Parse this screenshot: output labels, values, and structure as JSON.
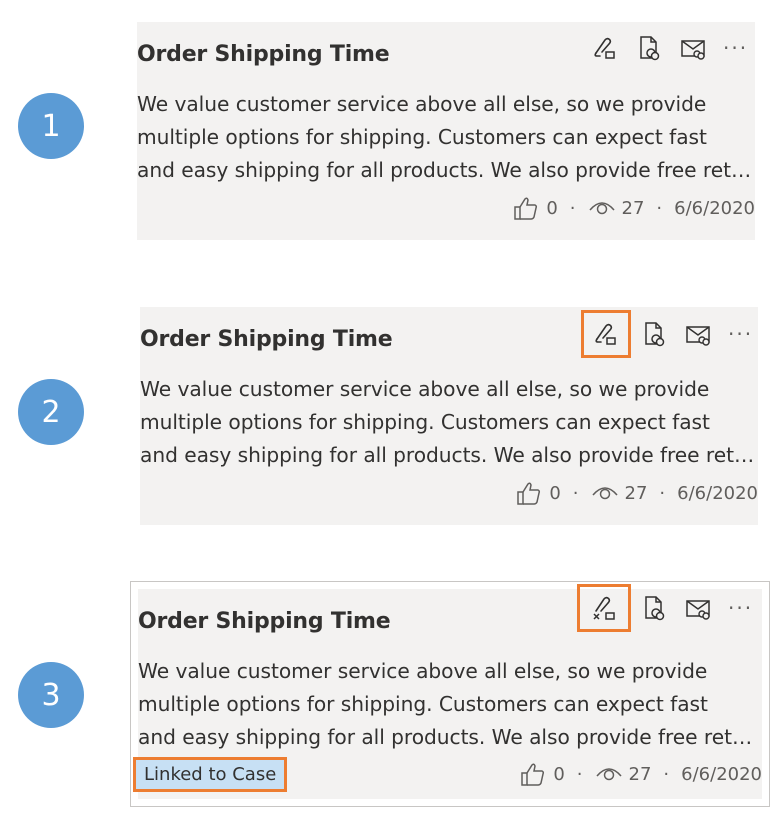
{
  "cards": [
    {
      "step": "1",
      "title": "Order Shipping Time",
      "lines": [
        "We value customer service above all else, so we provide",
        "multiple options for shipping. Customers can expect fast",
        "and easy shipping for all products. We also provide free returns"
      ],
      "likes": "0",
      "views": "27",
      "date": "6/6/2020",
      "more": "···",
      "link_action_state": "link",
      "highlight_link_icon": false
    },
    {
      "step": "2",
      "title": "Order Shipping Time",
      "lines": [
        "We value customer service above all else, so we provide",
        "multiple options for shipping. Customers can expect fast",
        "and easy shipping for all products. We also provide free returns"
      ],
      "likes": "0",
      "views": "27",
      "date": "6/6/2020",
      "more": "···",
      "link_action_state": "link",
      "highlight_link_icon": true
    },
    {
      "step": "3",
      "title": "Order Shipping Time",
      "lines": [
        "We value customer service above all else, so we provide",
        "multiple options for shipping. Customers can expect fast",
        "and easy shipping for all products. We also provide free returns"
      ],
      "likes": "0",
      "views": "27",
      "date": "6/6/2020",
      "more": "···",
      "link_action_state": "unlink",
      "highlight_link_icon": true,
      "badge": "Linked to Case"
    }
  ],
  "colors": {
    "step_circle": "#5b9bd5",
    "highlight": "#ed7d31",
    "card_bg": "#f3f2f1",
    "badge_bg": "#c7e0f4"
  },
  "icons": [
    "link-case-icon",
    "unlink-case-icon",
    "copy-link-icon",
    "email-icon",
    "like-icon",
    "views-icon"
  ]
}
